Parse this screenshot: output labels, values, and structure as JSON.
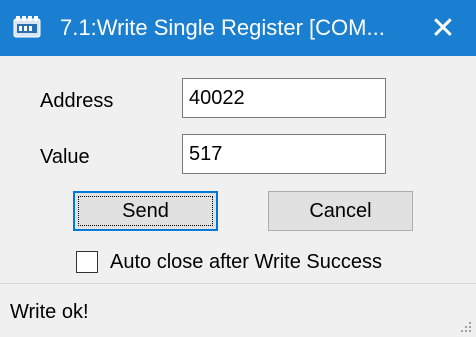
{
  "window": {
    "title": "7.1:Write Single Register [COM...",
    "close_glyph": "✕",
    "accent_color": "#1b7fd1"
  },
  "form": {
    "address_label": "Address",
    "address_value": "40022",
    "value_label": "Value",
    "value_value": "517"
  },
  "buttons": {
    "send_label": "Send",
    "cancel_label": "Cancel"
  },
  "options": {
    "auto_close_label": "Auto close after Write Success",
    "auto_close_checked": false
  },
  "statusbar": {
    "status_text": "Write ok!"
  },
  "icons": {
    "app": "modbus-app-icon",
    "close": "close-icon",
    "grip": "resize-grip-icon"
  }
}
